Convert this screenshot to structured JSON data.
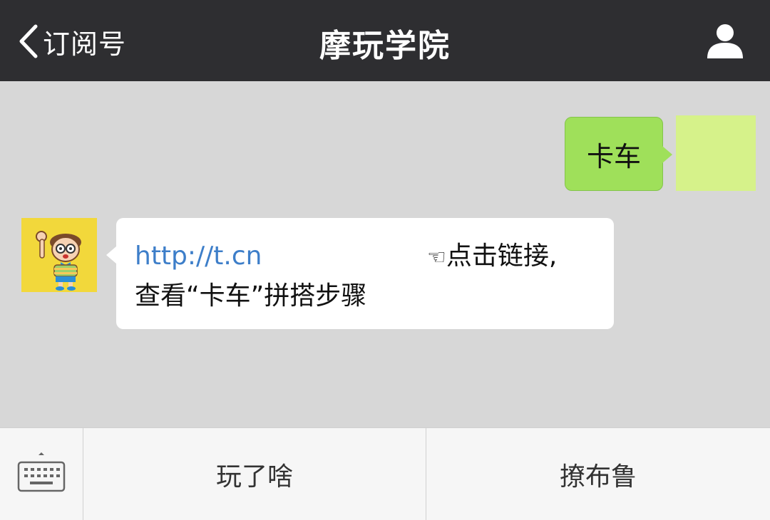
{
  "header": {
    "back_label": "订阅号",
    "title": "摩玩学院"
  },
  "messages": {
    "sent": {
      "text": "卡车"
    },
    "received": {
      "link_text": "http://t.cn",
      "hint_text": "点击链接,",
      "second_line": "查看“卡车”拼搭步骤"
    }
  },
  "menu": {
    "items": [
      {
        "label": "玩了啥"
      },
      {
        "label": "撩布鲁"
      }
    ]
  },
  "colors": {
    "header_bg": "#2e2e31",
    "sent_bubble": "#9fe05a",
    "link": "#3d7ec9",
    "chat_bg": "#d7d7d7"
  },
  "icons": {
    "back": "chevron-left-icon",
    "profile": "person-icon",
    "keyboard": "keyboard-icon",
    "hint": "pointing-hand-icon"
  }
}
